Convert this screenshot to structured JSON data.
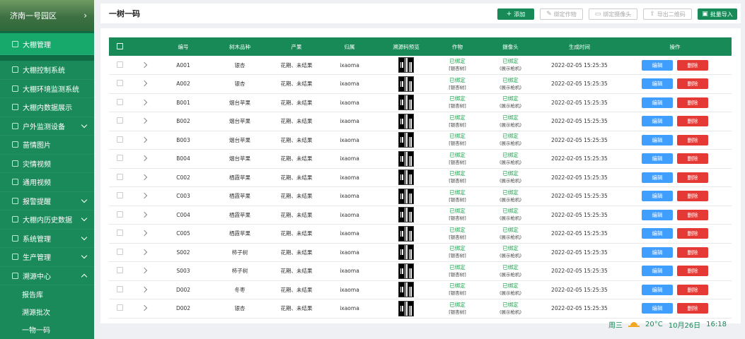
{
  "sidebar": {
    "header": "济南一号园区",
    "items": [
      {
        "label": "大棚管理",
        "icon": "home-icon",
        "active": true
      },
      {
        "label": "大棚控制系统",
        "icon": "control-icon"
      },
      {
        "label": "大棚环境监测系统",
        "icon": "monitor-icon"
      },
      {
        "label": "大棚内数据展示",
        "icon": "chart-icon"
      },
      {
        "label": "户外监测设备",
        "icon": "outdoor-icon",
        "arrow": "down"
      },
      {
        "label": "苗情图片",
        "icon": "seedling-icon"
      },
      {
        "label": "灾情视频",
        "icon": "bar-icon"
      },
      {
        "label": "通用视频",
        "icon": "video-icon"
      },
      {
        "label": "报警提醒",
        "icon": "warning-icon",
        "arrow": "down"
      },
      {
        "label": "大棚内历史数据",
        "icon": "history-icon",
        "arrow": "down"
      },
      {
        "label": "系统管理",
        "icon": "gear-icon",
        "arrow": "down"
      },
      {
        "label": "生产管理",
        "icon": "grid-icon",
        "arrow": "down"
      },
      {
        "label": "溯源中心",
        "icon": "trace-icon",
        "arrow": "up"
      }
    ],
    "subitems": [
      "报告库",
      "溯源批次",
      "一物一码"
    ]
  },
  "topbar": {
    "title": "一树一码",
    "add": "添加",
    "bind_crop": "绑定作物",
    "bind_camera": "绑定摄像头",
    "export_qr": "导出二维码",
    "batch_import": "批量导入"
  },
  "table": {
    "headers": [
      "编号",
      "树木品种",
      "产果",
      "归属",
      "溯源码预览",
      "作物",
      "摄像头",
      "生成时间",
      "操作"
    ],
    "rows": [
      {
        "id": "A001",
        "variety": "银杏",
        "fruit": "花期、未结果",
        "owner": "ixaoma",
        "crop": "已绑定",
        "crop_sub": "[银杏树]",
        "cam": "已绑定",
        "cam_sub": "(展示枪机)",
        "time": "2022-02-05  15:25:35"
      },
      {
        "id": "A002",
        "variety": "银杏",
        "fruit": "花期、未结果",
        "owner": "ixaoma",
        "crop": "已绑定",
        "crop_sub": "[银杏树]",
        "cam": "已绑定",
        "cam_sub": "(展示枪机)",
        "time": "2022-02-05  15:25:35"
      },
      {
        "id": "B001",
        "variety": "烟台苹果",
        "fruit": "花期、未结果",
        "owner": "ixaoma",
        "crop": "已绑定",
        "crop_sub": "[银杏树]",
        "cam": "已绑定",
        "cam_sub": "(展示枪机)",
        "time": "2022-02-05  15:25:35"
      },
      {
        "id": "B002",
        "variety": "烟台苹果",
        "fruit": "花期、未结果",
        "owner": "ixaoma",
        "crop": "已绑定",
        "crop_sub": "[银杏树]",
        "cam": "已绑定",
        "cam_sub": "(展示枪机)",
        "time": "2022-02-05  15:25:35"
      },
      {
        "id": "B003",
        "variety": "烟台苹果",
        "fruit": "花期、未结果",
        "owner": "ixaoma",
        "crop": "已绑定",
        "crop_sub": "[银杏树]",
        "cam": "已绑定",
        "cam_sub": "(展示枪机)",
        "time": "2022-02-05  15:25:35"
      },
      {
        "id": "B004",
        "variety": "烟台苹果",
        "fruit": "花期、未结果",
        "owner": "ixaoma",
        "crop": "已绑定",
        "crop_sub": "[银杏树]",
        "cam": "已绑定",
        "cam_sub": "(展示枪机)",
        "time": "2022-02-05  15:25:35"
      },
      {
        "id": "C002",
        "variety": "栖霞苹果",
        "fruit": "花期、未结果",
        "owner": "ixaoma",
        "crop": "已绑定",
        "crop_sub": "[银杏树]",
        "cam": "已绑定",
        "cam_sub": "(展示枪机)",
        "time": "2022-02-05  15:25:35"
      },
      {
        "id": "C003",
        "variety": "栖霞苹果",
        "fruit": "花期、未结果",
        "owner": "ixaoma",
        "crop": "已绑定",
        "crop_sub": "[银杏树]",
        "cam": "已绑定",
        "cam_sub": "(展示枪机)",
        "time": "2022-02-05  15:25:35"
      },
      {
        "id": "C004",
        "variety": "栖霞苹果",
        "fruit": "花期、未结果",
        "owner": "ixaoma",
        "crop": "已绑定",
        "crop_sub": "[银杏树]",
        "cam": "已绑定",
        "cam_sub": "(展示枪机)",
        "time": "2022-02-05  15:25:35"
      },
      {
        "id": "C005",
        "variety": "栖霞苹果",
        "fruit": "花期、未结果",
        "owner": "ixaoma",
        "crop": "已绑定",
        "crop_sub": "[银杏树]",
        "cam": "已绑定",
        "cam_sub": "(展示枪机)",
        "time": "2022-02-05  15:25:35"
      },
      {
        "id": "S002",
        "variety": "柿子树",
        "fruit": "花期、未结果",
        "owner": "ixaoma",
        "crop": "已绑定",
        "crop_sub": "[银杏树]",
        "cam": "已绑定",
        "cam_sub": "(展示枪机)",
        "time": "2022-02-05  15:25:35"
      },
      {
        "id": "S003",
        "variety": "柿子树",
        "fruit": "花期、未结果",
        "owner": "ixaoma",
        "crop": "已绑定",
        "crop_sub": "[银杏树]",
        "cam": "已绑定",
        "cam_sub": "(展示枪机)",
        "time": "2022-02-05  15:25:35"
      },
      {
        "id": "D002",
        "variety": "冬枣",
        "fruit": "花期、未结果",
        "owner": "ixaoma",
        "crop": "已绑定",
        "crop_sub": "[银杏树]",
        "cam": "已绑定",
        "cam_sub": "(展示枪机)",
        "time": "2022-02-05  15:25:35"
      },
      {
        "id": "D002",
        "variety": "银杏",
        "fruit": "花期、未结果",
        "owner": "ixaoma",
        "crop": "已绑定",
        "crop_sub": "[银杏树]",
        "cam": "已绑定",
        "cam_sub": "(展示枪机)",
        "time": "2022-02-05  15:25:35"
      }
    ],
    "edit_label": "编辑",
    "delete_label": "删除"
  },
  "footer": {
    "weekday": "周三",
    "temp": "20°C",
    "date": "10月26日",
    "time": "16:18"
  },
  "colors": {
    "primary": "#178a57",
    "edit": "#409eff",
    "delete": "#e53935"
  }
}
